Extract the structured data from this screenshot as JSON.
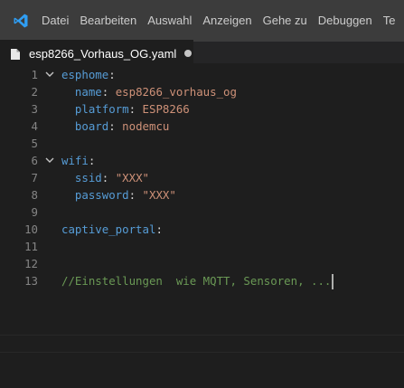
{
  "menu": [
    "Datei",
    "Bearbeiten",
    "Auswahl",
    "Anzeigen",
    "Gehe zu",
    "Debuggen",
    "Te"
  ],
  "tab": {
    "filename": "esp8266_Vorhaus_OG.yaml"
  },
  "lines": [
    {
      "n": "1",
      "k": "esphome",
      "p": ":",
      "v": ""
    },
    {
      "n": "2",
      "i": "  ",
      "k": "name",
      "p": ": ",
      "v": "esp8266_vorhaus_og"
    },
    {
      "n": "3",
      "i": "  ",
      "k": "platform",
      "p": ": ",
      "v": "ESP8266"
    },
    {
      "n": "4",
      "i": "  ",
      "k": "board",
      "p": ": ",
      "v": "nodemcu"
    },
    {
      "n": "5"
    },
    {
      "n": "6",
      "k": "wifi",
      "p": ":",
      "v": ""
    },
    {
      "n": "7",
      "i": "  ",
      "k": "ssid",
      "p": ": ",
      "v": "\"XXX\""
    },
    {
      "n": "8",
      "i": "  ",
      "k": "password",
      "p": ": ",
      "v": "\"XXX\""
    },
    {
      "n": "9"
    },
    {
      "n": "10",
      "k": "captive_portal",
      "p": ":",
      "v": ""
    },
    {
      "n": "11"
    },
    {
      "n": "12"
    },
    {
      "n": "13",
      "c": "//Einstellungen  wie MQTT, Sensoren, ..."
    }
  ]
}
